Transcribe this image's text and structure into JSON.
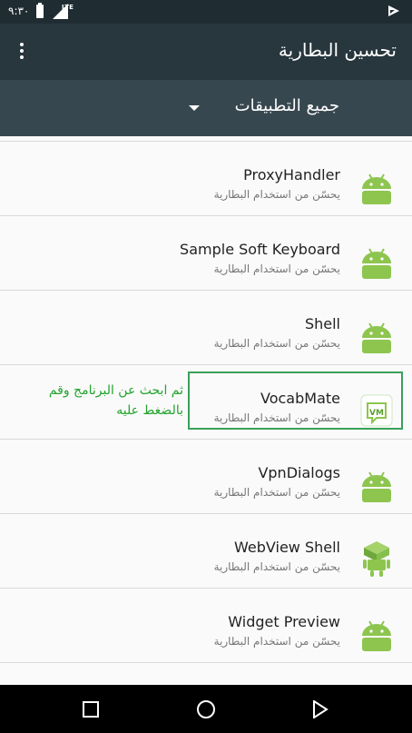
{
  "status_bar": {
    "time": "٩:٣٠",
    "network": "LTE"
  },
  "toolbar": {
    "title": "تحسين البطارية",
    "menu_icon": "more-vert-icon"
  },
  "filter": {
    "selected": "جميع التطبيقات"
  },
  "apps": [
    {
      "name": "ProxyHandler",
      "status": "يحسّن من استخدام البطارية",
      "icon": "android-icon"
    },
    {
      "name": "Sample Soft Keyboard",
      "status": "يحسّن من استخدام البطارية",
      "icon": "android-icon"
    },
    {
      "name": "Shell",
      "status": "يحسّن من استخدام البطارية",
      "icon": "android-icon"
    },
    {
      "name": "VocabMate",
      "status": "يحسّن من استخدام البطارية",
      "icon": "vocabmate-icon"
    },
    {
      "name": "VpnDialogs",
      "status": "يحسّن من استخدام البطارية",
      "icon": "android-icon"
    },
    {
      "name": "WebView Shell",
      "status": "يحسّن من استخدام البطارية",
      "icon": "webview-android-icon"
    },
    {
      "name": "Widget Preview",
      "status": "يحسّن من استخدام البطارية",
      "icon": "android-icon"
    }
  ],
  "annotation": {
    "text": "ثم ابحث عن البرنامج وقم بالضغط عليه",
    "color": "#22a32d"
  },
  "colors": {
    "toolbar": "#28363d",
    "filter_bar": "#37474f",
    "android_green": "#8dc54f",
    "highlight": "#3aa05a"
  },
  "nav_bar": {
    "back_icon": "back-icon",
    "home_icon": "home-icon",
    "recents_icon": "recents-icon"
  }
}
